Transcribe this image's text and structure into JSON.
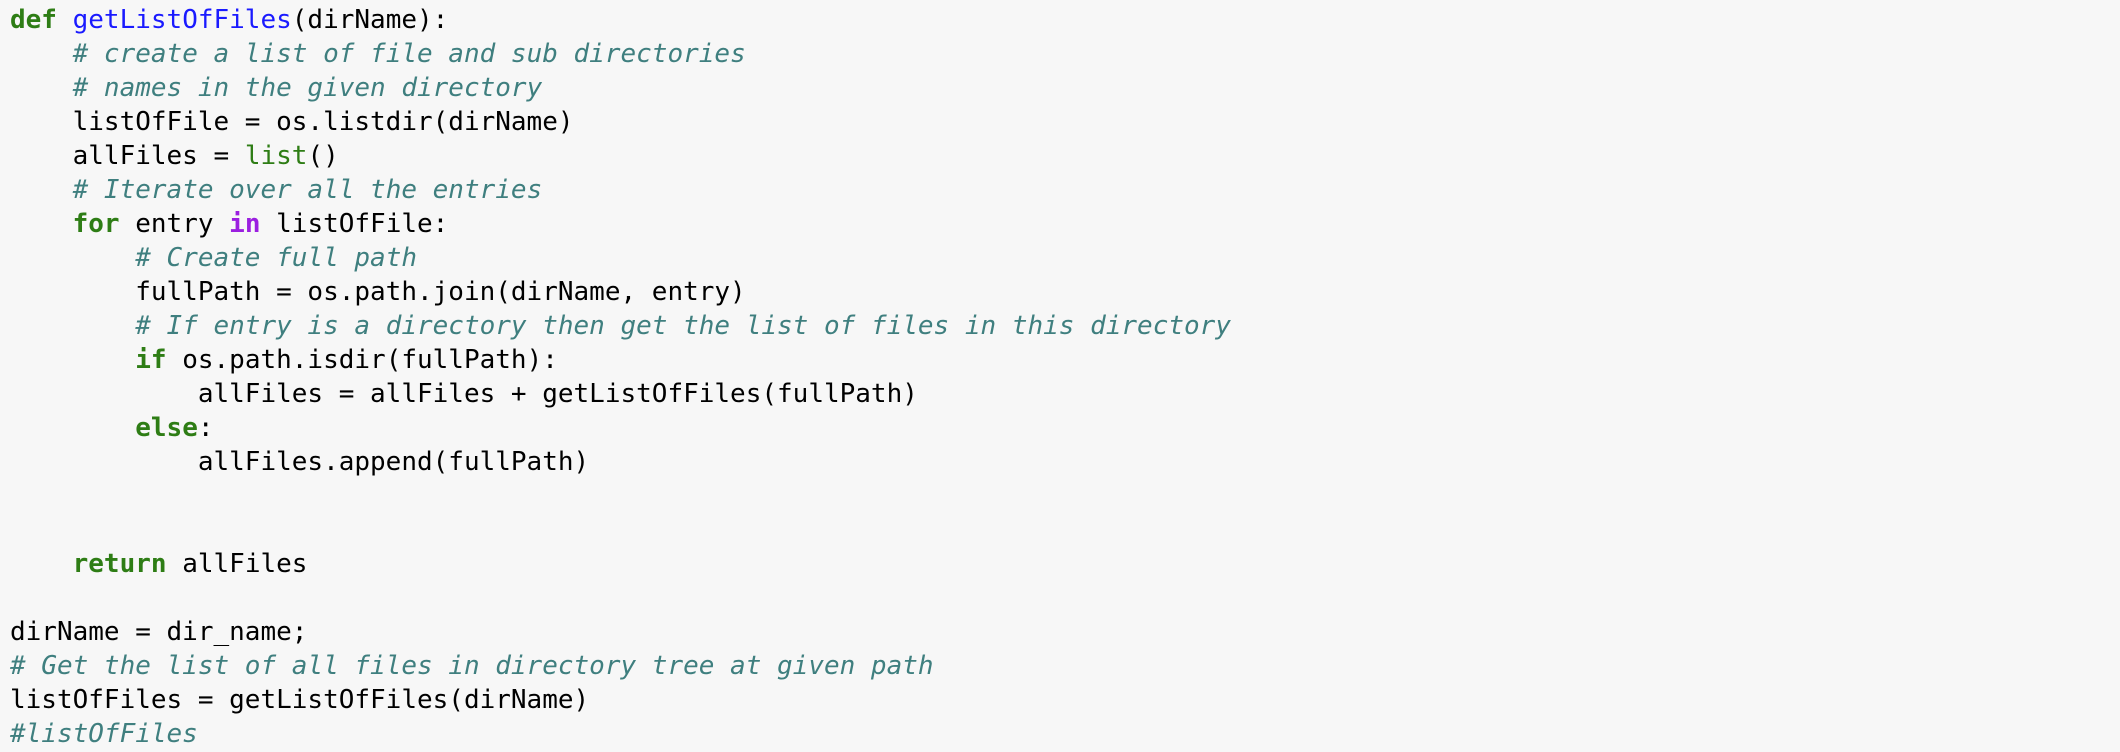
{
  "colors": {
    "background": "#f7f7f7",
    "keyword": "#2e7d15",
    "keyword_in": "#9b1fe0",
    "function_name": "#1a1aff",
    "builtin": "#2e7d15",
    "comment": "#3f7f7f",
    "text": "#000000"
  },
  "code": {
    "lines": [
      [
        {
          "t": "def",
          "c": "kw"
        },
        {
          "t": " ",
          "c": "id"
        },
        {
          "t": "getListOfFiles",
          "c": "fn"
        },
        {
          "t": "(dirName):",
          "c": "id"
        }
      ],
      [
        {
          "t": "    ",
          "c": "id"
        },
        {
          "t": "# create a list of file and sub directories",
          "c": "cm"
        }
      ],
      [
        {
          "t": "    ",
          "c": "id"
        },
        {
          "t": "# names in the given directory",
          "c": "cm"
        }
      ],
      [
        {
          "t": "    listOfFile = os.listdir(dirName)",
          "c": "id"
        }
      ],
      [
        {
          "t": "    allFiles = ",
          "c": "id"
        },
        {
          "t": "list",
          "c": "bi"
        },
        {
          "t": "()",
          "c": "id"
        }
      ],
      [
        {
          "t": "    ",
          "c": "id"
        },
        {
          "t": "# Iterate over all the entries",
          "c": "cm"
        }
      ],
      [
        {
          "t": "    ",
          "c": "id"
        },
        {
          "t": "for",
          "c": "kw"
        },
        {
          "t": " entry ",
          "c": "id"
        },
        {
          "t": "in",
          "c": "kwin"
        },
        {
          "t": " listOfFile:",
          "c": "id"
        }
      ],
      [
        {
          "t": "        ",
          "c": "id"
        },
        {
          "t": "# Create full path",
          "c": "cm"
        }
      ],
      [
        {
          "t": "        fullPath = os.path.join(dirName, entry)",
          "c": "id"
        }
      ],
      [
        {
          "t": "        ",
          "c": "id"
        },
        {
          "t": "# If entry is a directory then get the list of files in this directory",
          "c": "cm"
        }
      ],
      [
        {
          "t": "        ",
          "c": "id"
        },
        {
          "t": "if",
          "c": "kw"
        },
        {
          "t": " os.path.isdir(fullPath):",
          "c": "id"
        }
      ],
      [
        {
          "t": "            allFiles = allFiles + getListOfFiles(fullPath)",
          "c": "id"
        }
      ],
      [
        {
          "t": "        ",
          "c": "id"
        },
        {
          "t": "else",
          "c": "kw"
        },
        {
          "t": ":",
          "c": "id"
        }
      ],
      [
        {
          "t": "            allFiles.append(fullPath)",
          "c": "id"
        }
      ],
      [],
      [],
      [
        {
          "t": "    ",
          "c": "id"
        },
        {
          "t": "return",
          "c": "kw"
        },
        {
          "t": " allFiles",
          "c": "id"
        }
      ],
      [],
      [
        {
          "t": "dirName = dir_name;",
          "c": "id"
        }
      ],
      [
        {
          "t": "# Get the list of all files in directory tree at given path",
          "c": "cm"
        }
      ],
      [
        {
          "t": "listOfFiles = getListOfFiles(dirName)",
          "c": "id"
        }
      ],
      [
        {
          "t": "#listOfFiles",
          "c": "cm"
        }
      ]
    ]
  }
}
